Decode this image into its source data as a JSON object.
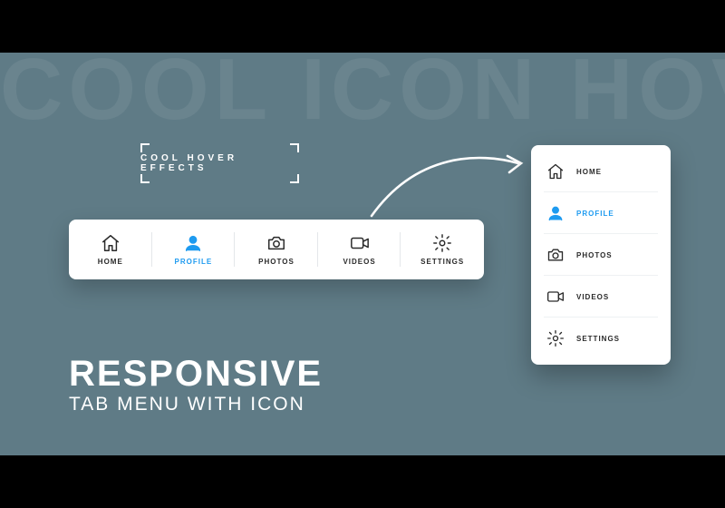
{
  "background_text": "COOL ICON HOVER",
  "hover_label": "COOL HOVER EFFECTS",
  "title_line1": "RESPONSIVE",
  "title_line2": "TAB MENU WITH ICON",
  "accent_color": "#1e9bf0",
  "bg_color": "#5f7b86",
  "active_index": 1,
  "menu": [
    {
      "label": "HOME",
      "icon": "home"
    },
    {
      "label": "PROFILE",
      "icon": "user"
    },
    {
      "label": "PHOTOS",
      "icon": "camera"
    },
    {
      "label": "VIDEOS",
      "icon": "video"
    },
    {
      "label": "SETTINGS",
      "icon": "gear"
    }
  ]
}
